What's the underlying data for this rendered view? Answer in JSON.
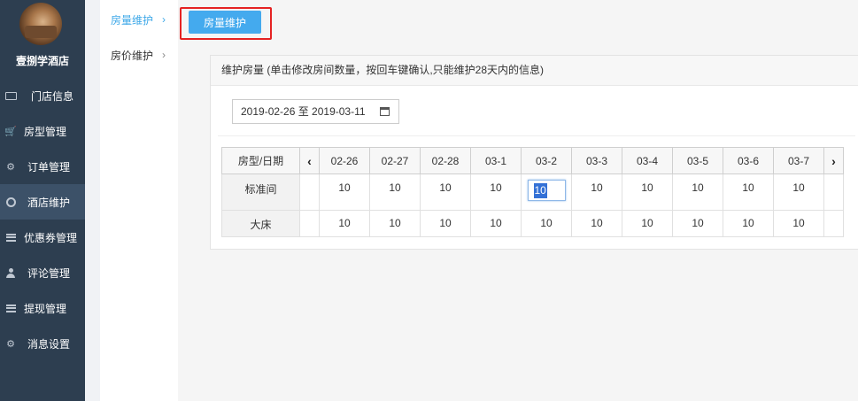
{
  "sidebar": {
    "hotel_name": "壹捌学酒店",
    "items": [
      {
        "label": "门店信息",
        "icon": "id-card-icon"
      },
      {
        "label": "房型管理",
        "icon": "cart-icon"
      },
      {
        "label": "订单管理",
        "icon": "gear-icon"
      },
      {
        "label": "酒店维护",
        "icon": "ring-icon"
      },
      {
        "label": "优惠券管理",
        "icon": "list-icon"
      },
      {
        "label": "评论管理",
        "icon": "user-icon"
      },
      {
        "label": "提现管理",
        "icon": "list-icon"
      },
      {
        "label": "消息设置",
        "icon": "gear-icon"
      }
    ],
    "active_index": 3
  },
  "subnav": {
    "items": [
      {
        "label": "房量维护",
        "arrow": "›"
      },
      {
        "label": "房价维护",
        "arrow": "›"
      }
    ],
    "active_index": 0
  },
  "tab": {
    "label": "房量维护"
  },
  "panel": {
    "title": "维护房量 (单击修改房间数量，按回车键确认,只能维护28天内的信息)",
    "date_range": "2019-02-26 至 2019-03-11"
  },
  "grid": {
    "header_label": "房型/日期",
    "prev_arrow": "‹",
    "next_arrow": "›",
    "dates": [
      "02-26",
      "02-27",
      "02-28",
      "03-1",
      "03-2",
      "03-3",
      "03-4",
      "03-5",
      "03-6",
      "03-7"
    ],
    "rows": [
      {
        "type": "标准间",
        "values": [
          "10",
          "10",
          "10",
          "10",
          "10",
          "10",
          "10",
          "10",
          "10",
          "10"
        ],
        "editing_index": 4
      },
      {
        "type": "大床",
        "values": [
          "10",
          "10",
          "10",
          "10",
          "10",
          "10",
          "10",
          "10",
          "10",
          "10"
        ]
      }
    ]
  },
  "colors": {
    "sidebar_bg": "#2d3e50",
    "accent": "#44aaee",
    "highlight": "#e52222"
  }
}
